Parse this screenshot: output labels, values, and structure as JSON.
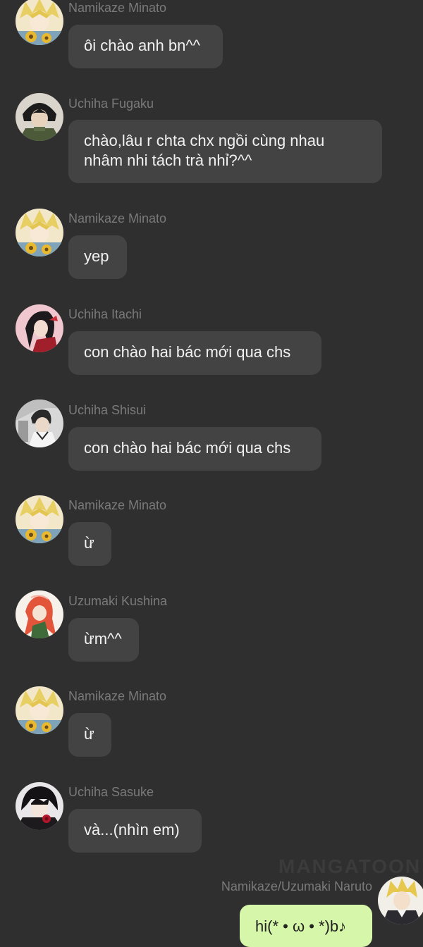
{
  "messages": [
    {
      "sender": "Namikaze Minato",
      "text": "ôi chào anh bn^^",
      "avatar": "minato-avatar"
    },
    {
      "sender": "Uchiha Fugaku",
      "text": "chào,lâu r chta chx ngồi cùng nhau\nnhâm nhi tách trà nhỉ?^^",
      "avatar": "fugaku-avatar"
    },
    {
      "sender": "Namikaze Minato",
      "text": "yep",
      "avatar": "minato-avatar"
    },
    {
      "sender": "Uchiha Itachi",
      "text": "con chào hai bác mới qua chs",
      "avatar": "itachi-avatar"
    },
    {
      "sender": "Uchiha Shisui",
      "text": "con chào hai bác mới qua chs",
      "avatar": "shisui-avatar"
    },
    {
      "sender": "Namikaze Minato",
      "text": "ừ",
      "avatar": "minato-avatar"
    },
    {
      "sender": "Uzumaki Kushina",
      "text": "ừm^^",
      "avatar": "kushina-avatar"
    },
    {
      "sender": "Namikaze Minato",
      "text": "ừ",
      "avatar": "minato-avatar"
    },
    {
      "sender": "Uchiha Sasuke",
      "text": "và...(nhìn em)",
      "avatar": "sasuke-avatar"
    }
  ],
  "self_message": {
    "sender": "Namikaze/Uzumaki Naruto",
    "text": "hi(* • ω • *)b♪",
    "avatar": "naruto-avatar"
  },
  "watermark": "MANGATOON",
  "colors": {
    "background": "#2f2f2f",
    "bubble": "#434343",
    "self_bubble": "#d6f6a9",
    "sender_text": "#7a7a7a"
  }
}
